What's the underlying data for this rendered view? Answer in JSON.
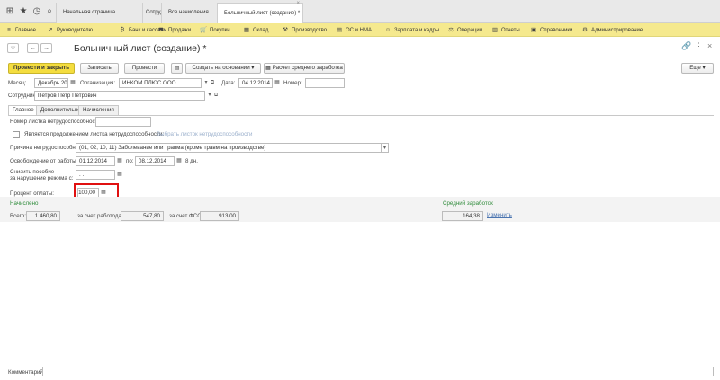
{
  "tabs": [
    "Начальная страница",
    "Сотрудники",
    "Все начисления",
    "Больничный лист (создание) *"
  ],
  "menu": [
    {
      "icon": "≡",
      "label": "Главное"
    },
    {
      "icon": "↗",
      "label": "Руководителю"
    },
    {
      "icon": "₿",
      "label": "Банк и касса"
    },
    {
      "icon": "⛟",
      "label": "Продажи"
    },
    {
      "icon": "🛒",
      "label": "Покупки"
    },
    {
      "icon": "▦",
      "label": "Склад"
    },
    {
      "icon": "⚒",
      "label": "Производство"
    },
    {
      "icon": "▤",
      "label": "ОС и НМА"
    },
    {
      "icon": "☺",
      "label": "Зарплата и кадры"
    },
    {
      "icon": "⚖",
      "label": "Операции"
    },
    {
      "icon": "▥",
      "label": "Отчеты"
    },
    {
      "icon": "▣",
      "label": "Справочники"
    },
    {
      "icon": "⚙",
      "label": "Администрирование"
    }
  ],
  "title": "Больничный лист (создание) *",
  "toolbar": {
    "post_close": "Провести и закрыть",
    "save": "Записать",
    "post": "Провести",
    "create_based": "Создать на основании",
    "calc_avg": "Расчет среднего заработка",
    "more": "Еще"
  },
  "header": {
    "month_label": "Месяц:",
    "month_value": "Декабрь 2014",
    "org_label": "Организация:",
    "org_value": "ИНКОМ ПЛЮС ООО",
    "date_label": "Дата:",
    "date_value": "04.12.2014",
    "number_label": "Номер:",
    "number_value": "",
    "employee_label": "Сотрудник:",
    "employee_value": "Петров Петр Петрович"
  },
  "subtabs": [
    "Главное",
    "Дополнительно",
    "Начисления"
  ],
  "main": {
    "sick_number_label": "Номер листка нетрудоспособности:",
    "continuation_label": "Является продолжением листка нетрудоспособности:",
    "choose_link": "Выбрать листок нетрудоспособности",
    "reason_label": "Причина нетрудоспособн.:",
    "reason_value": "(01, 02, 10, 11) Заболевание или травма (кроме травм на производстве)",
    "release_label": "Освобождение от работы с:",
    "release_from": "01.12.2014",
    "release_to_label": "по:",
    "release_to": "08.12.2014",
    "days": "8 дн.",
    "reduce_label_1": "Снизить пособие",
    "reduce_label_2": "за нарушение режима с:",
    "reduce_value": ". .",
    "percent_label": "Процент оплаты:",
    "percent_value": "100,00"
  },
  "accrued": {
    "title": "Начислено",
    "total_label": "Всего:",
    "total_value": "1 460,80",
    "employer_label": "за счет работодат.:",
    "employer_value": "547,80",
    "fss_label": "за счет ФСС:",
    "fss_value": "913,00"
  },
  "avg_earnings": {
    "title": "Средний заработок",
    "value": "164,38",
    "change_link": "Изменить"
  },
  "comment_label": "Комментарий:"
}
